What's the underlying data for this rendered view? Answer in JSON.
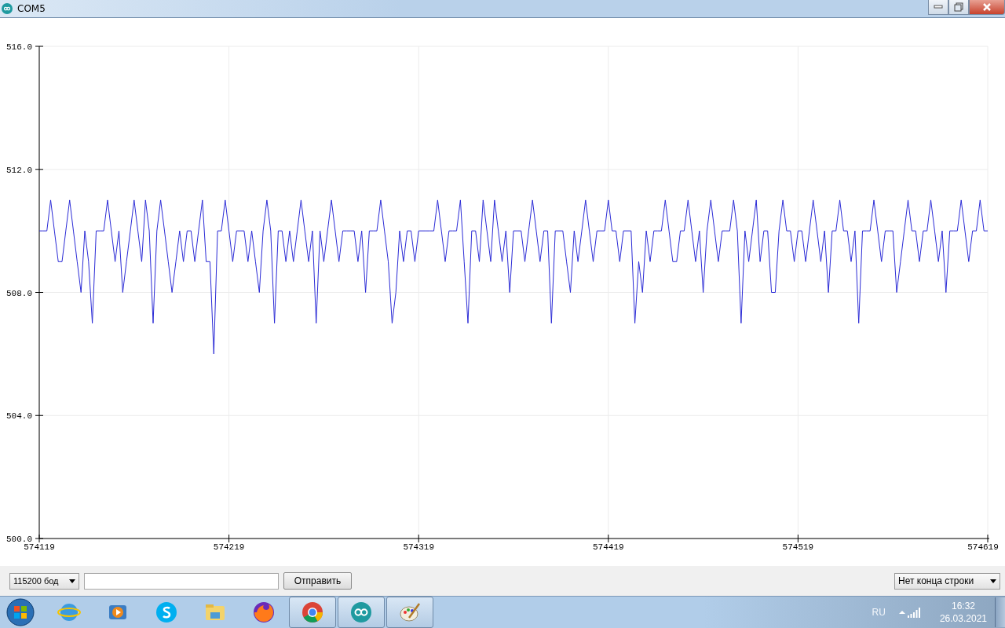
{
  "window": {
    "title": "COM5"
  },
  "plot": {
    "chart_data": {
      "type": "line",
      "grid": true,
      "xlim": [
        574119,
        574619
      ],
      "ylim": [
        500,
        516
      ],
      "xticks": [
        {
          "value": 574119,
          "label": "574119"
        },
        {
          "value": 574219,
          "label": "574219"
        },
        {
          "value": 574319,
          "label": "574319"
        },
        {
          "value": 574419,
          "label": "574419"
        },
        {
          "value": 574519,
          "label": "574519"
        },
        {
          "value": 574619,
          "label": "574619"
        }
      ],
      "yticks": [
        {
          "value": 500,
          "label": "500.0"
        },
        {
          "value": 504,
          "label": "504.0"
        },
        {
          "value": 508,
          "label": "508.0"
        },
        {
          "value": 512,
          "label": "512.0"
        },
        {
          "value": 516,
          "label": "516.0"
        }
      ],
      "x": [
        574119,
        574121,
        574123,
        574125,
        574127,
        574129,
        574131,
        574133,
        574135,
        574137,
        574139,
        574141,
        574143,
        574145,
        574147,
        574149,
        574151,
        574153,
        574155,
        574157,
        574159,
        574161,
        574163,
        574165,
        574167,
        574169,
        574171,
        574173,
        574175,
        574177,
        574179,
        574181,
        574183,
        574185,
        574187,
        574189,
        574191,
        574193,
        574195,
        574197,
        574199,
        574201,
        574203,
        574205,
        574207,
        574209,
        574211,
        574213,
        574215,
        574217,
        574219,
        574221,
        574223,
        574225,
        574227,
        574229,
        574231,
        574233,
        574235,
        574237,
        574239,
        574241,
        574243,
        574245,
        574247,
        574249,
        574251,
        574253,
        574255,
        574257,
        574259,
        574261,
        574263,
        574265,
        574267,
        574269,
        574271,
        574273,
        574275,
        574277,
        574279,
        574281,
        574283,
        574285,
        574287,
        574289,
        574291,
        574293,
        574295,
        574297,
        574299,
        574301,
        574303,
        574305,
        574307,
        574309,
        574311,
        574313,
        574315,
        574317,
        574319,
        574321,
        574323,
        574325,
        574327,
        574329,
        574331,
        574333,
        574335,
        574337,
        574339,
        574341,
        574343,
        574345,
        574347,
        574349,
        574351,
        574353,
        574355,
        574357,
        574359,
        574361,
        574363,
        574365,
        574367,
        574369,
        574371,
        574373,
        574375,
        574377,
        574379,
        574381,
        574383,
        574385,
        574387,
        574389,
        574391,
        574393,
        574395,
        574397,
        574399,
        574401,
        574403,
        574405,
        574407,
        574409,
        574411,
        574413,
        574415,
        574417,
        574419,
        574421,
        574423,
        574425,
        574427,
        574429,
        574431,
        574433,
        574435,
        574437,
        574439,
        574441,
        574443,
        574445,
        574447,
        574449,
        574451,
        574453,
        574455,
        574457,
        574459,
        574461,
        574463,
        574465,
        574467,
        574469,
        574471,
        574473,
        574475,
        574477,
        574479,
        574481,
        574483,
        574485,
        574487,
        574489,
        574491,
        574493,
        574495,
        574497,
        574499,
        574501,
        574503,
        574505,
        574507,
        574509,
        574511,
        574513,
        574515,
        574517,
        574519,
        574521,
        574523,
        574525,
        574527,
        574529,
        574531,
        574533,
        574535,
        574537,
        574539,
        574541,
        574543,
        574545,
        574547,
        574549,
        574551,
        574553,
        574555,
        574557,
        574559,
        574561,
        574563,
        574565,
        574567,
        574569,
        574571,
        574573,
        574575,
        574577,
        574579,
        574581,
        574583,
        574585,
        574587,
        574589,
        574591,
        574593,
        574595,
        574597,
        574599,
        574601,
        574603,
        574605,
        574607,
        574609,
        574611,
        574613,
        574615,
        574617,
        574619
      ],
      "series": [
        {
          "color": "#2b2bd6",
          "values": [
            510,
            510,
            510,
            511,
            510,
            509,
            509,
            510,
            511,
            510,
            509,
            508,
            510,
            509,
            507,
            510,
            510,
            510,
            511,
            510,
            509,
            510,
            508,
            509,
            510,
            511,
            510,
            509,
            511,
            510,
            507,
            510,
            511,
            510,
            509,
            508,
            509,
            510,
            509,
            510,
            510,
            509,
            510,
            511,
            509,
            509,
            506,
            510,
            510,
            511,
            510,
            509,
            510,
            510,
            510,
            509,
            510,
            509,
            508,
            510,
            511,
            510,
            507,
            510,
            510,
            509,
            510,
            509,
            510,
            511,
            510,
            509,
            510,
            507,
            510,
            509,
            510,
            511,
            510,
            509,
            510,
            510,
            510,
            510,
            509,
            510,
            508,
            510,
            510,
            510,
            511,
            510,
            509,
            507,
            508,
            510,
            509,
            510,
            510,
            509,
            510,
            510,
            510,
            510,
            510,
            511,
            510,
            509,
            510,
            510,
            510,
            511,
            509,
            507,
            510,
            510,
            509,
            511,
            510,
            509,
            511,
            510,
            509,
            510,
            508,
            510,
            510,
            510,
            509,
            510,
            511,
            510,
            509,
            510,
            510,
            507,
            510,
            510,
            510,
            509,
            508,
            510,
            509,
            510,
            511,
            510,
            509,
            510,
            510,
            510,
            511,
            510,
            510,
            509,
            510,
            510,
            510,
            507,
            509,
            508,
            510,
            509,
            510,
            510,
            510,
            511,
            510,
            509,
            509,
            510,
            510,
            511,
            510,
            509,
            510,
            508,
            510,
            511,
            510,
            509,
            510,
            510,
            510,
            511,
            510,
            507,
            510,
            509,
            510,
            511,
            509,
            510,
            510,
            508,
            508,
            510,
            511,
            510,
            510,
            509,
            510,
            510,
            509,
            510,
            511,
            510,
            509,
            510,
            508,
            510,
            510,
            511,
            510,
            510,
            509,
            510,
            507,
            510,
            510,
            510,
            511,
            510,
            509,
            510,
            510,
            510,
            508,
            509,
            510,
            511,
            510,
            510,
            509,
            510,
            510,
            511,
            510,
            509,
            510,
            508,
            510,
            510,
            510,
            511,
            510,
            509,
            510,
            510,
            511,
            510,
            510
          ]
        }
      ]
    }
  },
  "controls": {
    "baud": "115200 бод",
    "send_button": "Отправить",
    "line_ending": "Нет конца строки"
  },
  "taskbar": {
    "apps": [
      {
        "kind": "ie",
        "selected": false
      },
      {
        "kind": "media",
        "selected": false
      },
      {
        "kind": "skype",
        "selected": false
      },
      {
        "kind": "explorer",
        "selected": false
      },
      {
        "kind": "firefox",
        "selected": false
      },
      {
        "kind": "chrome",
        "selected": true
      },
      {
        "kind": "arduino",
        "selected": true
      },
      {
        "kind": "paint",
        "selected": true
      }
    ],
    "language": "RU",
    "time": "16:32",
    "date": "26.03.2021"
  }
}
